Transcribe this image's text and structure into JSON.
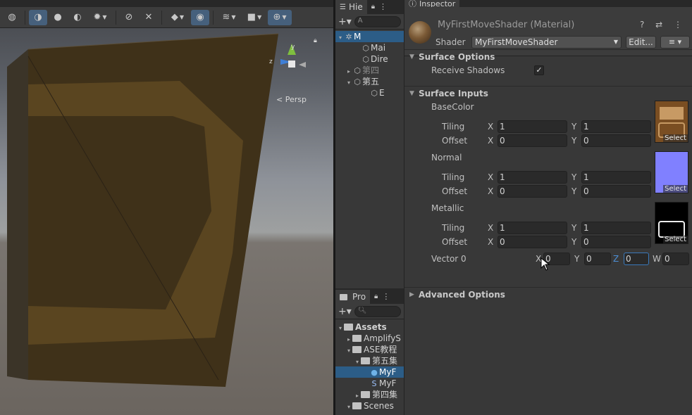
{
  "scene": {
    "persp_label": "< Persp",
    "gizmo": {
      "y": "y",
      "z": "z"
    },
    "toolbar": {
      "buttons": [
        {
          "name": "globe-icon",
          "glyph": "◍",
          "active": false
        },
        {
          "name": "shading-icon",
          "glyph": "◑",
          "active": true
        },
        {
          "name": "sphere-shaded-icon",
          "glyph": "●",
          "active": false
        },
        {
          "name": "sphere-wire-icon",
          "glyph": "◐",
          "active": false
        },
        {
          "name": "debug-icon",
          "glyph": "✹",
          "active": false,
          "dropdown": true
        },
        {
          "name": "lighting-toggle-icon",
          "glyph": "⊘",
          "active": false
        },
        {
          "name": "audio-toggle-icon",
          "glyph": "✕",
          "active": false
        },
        {
          "name": "effects-icon",
          "glyph": "◆",
          "active": false,
          "dropdown": true
        },
        {
          "name": "visibility-icon",
          "glyph": "◉",
          "active": true
        },
        {
          "name": "layers-icon",
          "glyph": "≋",
          "active": false,
          "dropdown": true
        },
        {
          "name": "camera-icon",
          "glyph": "■",
          "active": false,
          "dropdown": true
        },
        {
          "name": "gizmos-icon",
          "glyph": "⊕",
          "active": true,
          "dropdown": true
        }
      ]
    }
  },
  "hierarchy": {
    "tab_label": "Hie",
    "search_placeholder": "A",
    "rows": [
      {
        "label": "M",
        "indent": 0,
        "tri": "▾",
        "icon": "unity",
        "selected": true,
        "dim": false
      },
      {
        "label": "Mai",
        "indent": 2,
        "tri": "",
        "icon": "cube",
        "selected": false,
        "dim": false
      },
      {
        "label": "Dire",
        "indent": 2,
        "tri": "",
        "icon": "cube",
        "selected": false,
        "dim": false
      },
      {
        "label": "第四",
        "indent": 1,
        "tri": "▸",
        "icon": "cube",
        "selected": false,
        "dim": true
      },
      {
        "label": "第五",
        "indent": 1,
        "tri": "▾",
        "icon": "cube",
        "selected": false,
        "dim": false
      },
      {
        "label": "E",
        "indent": 3,
        "tri": "",
        "icon": "cube",
        "selected": false,
        "dim": false
      }
    ]
  },
  "project": {
    "tab_label": "Pro",
    "rows": [
      {
        "label": "Assets",
        "indent": 0,
        "tri": "▾",
        "icon": "folder",
        "selected": false,
        "bold": true
      },
      {
        "label": "AmplifyS",
        "indent": 1,
        "tri": "▸",
        "icon": "folder",
        "selected": false
      },
      {
        "label": "ASE教程",
        "indent": 1,
        "tri": "▾",
        "icon": "folder",
        "selected": false
      },
      {
        "label": "第五集",
        "indent": 2,
        "tri": "▾",
        "icon": "folder",
        "selected": false
      },
      {
        "label": "MyF",
        "indent": 3,
        "tri": "",
        "icon": "material",
        "selected": true
      },
      {
        "label": "MyF",
        "indent": 3,
        "tri": "",
        "icon": "shader",
        "selected": false
      },
      {
        "label": "第四集",
        "indent": 2,
        "tri": "▸",
        "icon": "folder",
        "selected": false
      },
      {
        "label": "Scenes",
        "indent": 1,
        "tri": "▾",
        "icon": "folder",
        "selected": false
      }
    ]
  },
  "inspector": {
    "tab_label": "Inspector",
    "material_title": "MyFirstMoveShader (Material)",
    "shader_label": "Shader",
    "shader_value": "MyFirstMoveShader",
    "edit_label": "Edit...",
    "menu_icon": "≡ ▾",
    "header_icons": "? ⇄ ⋮",
    "surface_options": {
      "title": "Surface Options",
      "receive_shadows_label": "Receive Shadows",
      "receive_shadows_checked": "✓"
    },
    "surface_inputs": {
      "title": "Surface Inputs",
      "textures": [
        {
          "name": "BaseColor",
          "tiling_x": "1",
          "tiling_y": "1",
          "offset_x": "0",
          "offset_y": "0",
          "swatch": "#7a4e22"
        },
        {
          "name": "Normal",
          "tiling_x": "1",
          "tiling_y": "1",
          "offset_x": "0",
          "offset_y": "0",
          "swatch": "#8080ff"
        },
        {
          "name": "Metallic",
          "tiling_x": "1",
          "tiling_y": "1",
          "offset_x": "0",
          "offset_y": "0",
          "swatch": "#000000"
        }
      ],
      "tiling_label": "Tiling",
      "offset_label": "Offset",
      "select_label": "Select",
      "vector": {
        "label": "Vector 0",
        "x": "0",
        "y": "0",
        "z": "0",
        "w": "0"
      }
    },
    "advanced_options": {
      "title": "Advanced Options"
    },
    "axis_labels": {
      "x": "X",
      "y": "Y",
      "z": "Z",
      "w": "W"
    }
  }
}
